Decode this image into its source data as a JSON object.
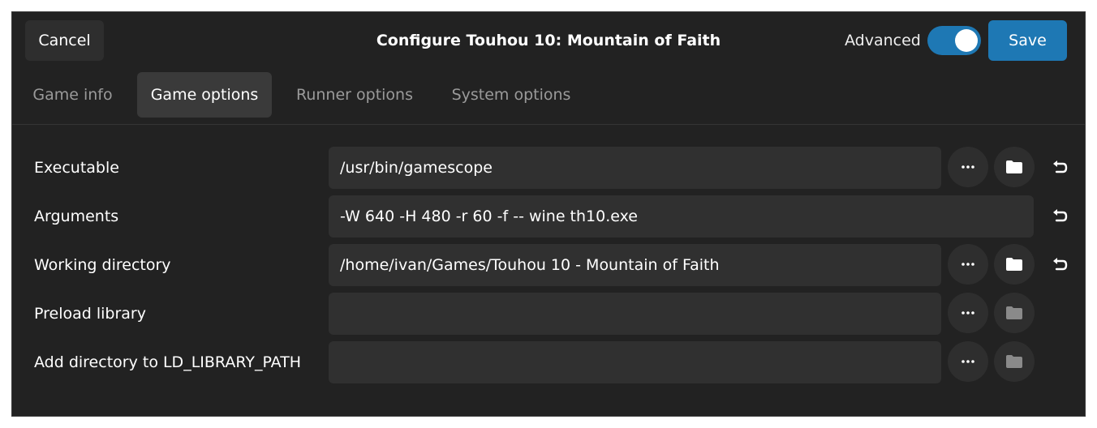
{
  "header": {
    "cancel_label": "Cancel",
    "title": "Configure Touhou 10: Mountain of Faith",
    "advanced_label": "Advanced",
    "advanced_enabled": true,
    "save_label": "Save"
  },
  "tabs": [
    {
      "label": "Game info",
      "active": false
    },
    {
      "label": "Game options",
      "active": true
    },
    {
      "label": "Runner options",
      "active": false
    },
    {
      "label": "System options",
      "active": false
    }
  ],
  "rows": {
    "executable": {
      "label": "Executable",
      "value": "/usr/bin/gamescope"
    },
    "arguments": {
      "label": "Arguments",
      "value": "-W 640 -H 480 -r 60 -f -- wine th10.exe"
    },
    "working_directory": {
      "label": "Working directory",
      "value": "/home/ivan/Games/Touhou 10 - Mountain of Faith"
    },
    "preload_library": {
      "label": "Preload library",
      "value": ""
    },
    "ld_library_path": {
      "label": "Add directory to LD_LIBRARY_PATH",
      "value": ""
    }
  },
  "icons": {
    "more": "more-horizontal-icon",
    "folder": "folder-icon",
    "reset": "undo-icon"
  },
  "colors": {
    "accent": "#1e78b4",
    "background": "#222222",
    "entry": "#303030"
  }
}
